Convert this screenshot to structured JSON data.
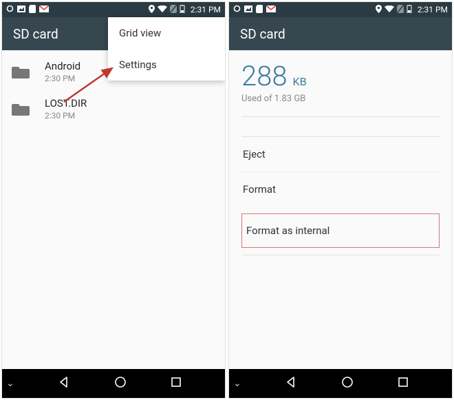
{
  "status": {
    "time": "2:31 PM"
  },
  "left": {
    "app_bar_title": "SD card",
    "menu": {
      "grid_view": "Grid view",
      "settings": "Settings"
    },
    "folders": [
      {
        "name": "Android",
        "time": "2:30 PM"
      },
      {
        "name": "LOST.DIR",
        "time": "2:30 PM"
      }
    ]
  },
  "right": {
    "app_bar_title": "SD card",
    "used_value": "288",
    "used_unit": "KB",
    "used_sub": "Used of 1.83 GB",
    "actions": {
      "eject": "Eject",
      "format": "Format",
      "format_internal": "Format as internal"
    }
  }
}
